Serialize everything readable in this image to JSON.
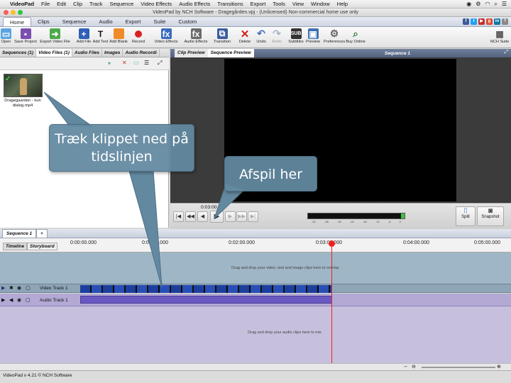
{
  "mac_menu": {
    "app": "VideoPad",
    "items": [
      "File",
      "Edit",
      "Clip",
      "Track",
      "Sequence",
      "Video Effects",
      "Audio Effects",
      "Transitions",
      "Export",
      "Tools",
      "View",
      "Window",
      "Help"
    ]
  },
  "window": {
    "title": "VideoPad by NCH Software - Dragegården.vpj - (Unlicensed) Non-commercial home use only"
  },
  "main_tabs": [
    {
      "label": "Home"
    },
    {
      "label": "Clips"
    },
    {
      "label": "Sequence"
    },
    {
      "label": "Audio"
    },
    {
      "label": "Export"
    },
    {
      "label": "Suite"
    },
    {
      "label": "Custom"
    }
  ],
  "toolbar": {
    "open": "Open",
    "save_project": "Save Project",
    "export_video": "Export Video File",
    "add_file": "Add File",
    "add_text": "Add Text",
    "add_blank": "Add Blank",
    "record": "Record",
    "video_effects": "Video Effects",
    "audio_effects": "Audio Effects",
    "transition": "Transition",
    "delete": "Delete",
    "undo": "Undo",
    "redo": "Redo",
    "subtitles": "Subtitles",
    "preview": "Preview",
    "preferences": "Preferences",
    "buy_online": "Buy Online",
    "nch_suite": "NCH Suite"
  },
  "bin_tabs": [
    {
      "label": "Sequences (1)"
    },
    {
      "label": "Video Files (1)"
    },
    {
      "label": "Audio Files"
    },
    {
      "label": "Images"
    },
    {
      "label": "Audio Recordi"
    }
  ],
  "bin": {
    "clip_label": "Dragegaarden - kun dialog.mp4"
  },
  "preview_tabs": [
    {
      "label": "Clip Preview"
    },
    {
      "label": "Sequence Preview"
    }
  ],
  "preview": {
    "title": "Sequence 1",
    "timecode": "0:03:00.83",
    "split": "Split",
    "snapshot": "Snapshot",
    "meter_scale": [
      "-42",
      "-36",
      "-30",
      "-24",
      "-18",
      "-12",
      "-6",
      "0"
    ]
  },
  "sequence_tab": {
    "label": "Sequence 1"
  },
  "timeline": {
    "timeline_tab": "Timeline",
    "storyboard_tab": "Storyboard",
    "ticks": [
      "0:00:00.000",
      "0:01:00.000",
      "0:02:00.000",
      "0:03:00.000",
      "0:04:00.000",
      "0:05:00.000"
    ],
    "overlay_hint": "Drag and drop your video, text and image clips here to overlay",
    "video_track": "Video Track 1",
    "audio_track": "Audio Track 1",
    "audio_hint": "Drag and drop your audio clips here to mix",
    "playhead": 0.6
  },
  "status": {
    "text": "VideoPad v 4.21 © NCH Software"
  },
  "callouts": {
    "drag": "Træk klippet ned på tidslinjen",
    "play": "Afspil her"
  }
}
